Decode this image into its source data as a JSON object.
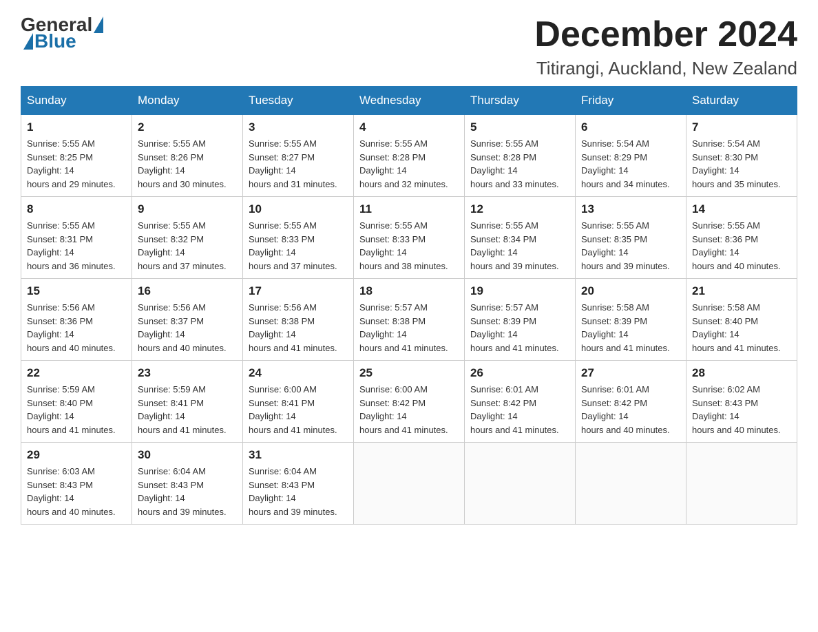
{
  "logo": {
    "general": "General",
    "blue": "Blue"
  },
  "title": "December 2024",
  "subtitle": "Titirangi, Auckland, New Zealand",
  "weekdays": [
    "Sunday",
    "Monday",
    "Tuesday",
    "Wednesday",
    "Thursday",
    "Friday",
    "Saturday"
  ],
  "weeks": [
    [
      {
        "day": "1",
        "sunrise": "5:55 AM",
        "sunset": "8:25 PM",
        "daylight": "14 hours and 29 minutes."
      },
      {
        "day": "2",
        "sunrise": "5:55 AM",
        "sunset": "8:26 PM",
        "daylight": "14 hours and 30 minutes."
      },
      {
        "day": "3",
        "sunrise": "5:55 AM",
        "sunset": "8:27 PM",
        "daylight": "14 hours and 31 minutes."
      },
      {
        "day": "4",
        "sunrise": "5:55 AM",
        "sunset": "8:28 PM",
        "daylight": "14 hours and 32 minutes."
      },
      {
        "day": "5",
        "sunrise": "5:55 AM",
        "sunset": "8:28 PM",
        "daylight": "14 hours and 33 minutes."
      },
      {
        "day": "6",
        "sunrise": "5:54 AM",
        "sunset": "8:29 PM",
        "daylight": "14 hours and 34 minutes."
      },
      {
        "day": "7",
        "sunrise": "5:54 AM",
        "sunset": "8:30 PM",
        "daylight": "14 hours and 35 minutes."
      }
    ],
    [
      {
        "day": "8",
        "sunrise": "5:55 AM",
        "sunset": "8:31 PM",
        "daylight": "14 hours and 36 minutes."
      },
      {
        "day": "9",
        "sunrise": "5:55 AM",
        "sunset": "8:32 PM",
        "daylight": "14 hours and 37 minutes."
      },
      {
        "day": "10",
        "sunrise": "5:55 AM",
        "sunset": "8:33 PM",
        "daylight": "14 hours and 37 minutes."
      },
      {
        "day": "11",
        "sunrise": "5:55 AM",
        "sunset": "8:33 PM",
        "daylight": "14 hours and 38 minutes."
      },
      {
        "day": "12",
        "sunrise": "5:55 AM",
        "sunset": "8:34 PM",
        "daylight": "14 hours and 39 minutes."
      },
      {
        "day": "13",
        "sunrise": "5:55 AM",
        "sunset": "8:35 PM",
        "daylight": "14 hours and 39 minutes."
      },
      {
        "day": "14",
        "sunrise": "5:55 AM",
        "sunset": "8:36 PM",
        "daylight": "14 hours and 40 minutes."
      }
    ],
    [
      {
        "day": "15",
        "sunrise": "5:56 AM",
        "sunset": "8:36 PM",
        "daylight": "14 hours and 40 minutes."
      },
      {
        "day": "16",
        "sunrise": "5:56 AM",
        "sunset": "8:37 PM",
        "daylight": "14 hours and 40 minutes."
      },
      {
        "day": "17",
        "sunrise": "5:56 AM",
        "sunset": "8:38 PM",
        "daylight": "14 hours and 41 minutes."
      },
      {
        "day": "18",
        "sunrise": "5:57 AM",
        "sunset": "8:38 PM",
        "daylight": "14 hours and 41 minutes."
      },
      {
        "day": "19",
        "sunrise": "5:57 AM",
        "sunset": "8:39 PM",
        "daylight": "14 hours and 41 minutes."
      },
      {
        "day": "20",
        "sunrise": "5:58 AM",
        "sunset": "8:39 PM",
        "daylight": "14 hours and 41 minutes."
      },
      {
        "day": "21",
        "sunrise": "5:58 AM",
        "sunset": "8:40 PM",
        "daylight": "14 hours and 41 minutes."
      }
    ],
    [
      {
        "day": "22",
        "sunrise": "5:59 AM",
        "sunset": "8:40 PM",
        "daylight": "14 hours and 41 minutes."
      },
      {
        "day": "23",
        "sunrise": "5:59 AM",
        "sunset": "8:41 PM",
        "daylight": "14 hours and 41 minutes."
      },
      {
        "day": "24",
        "sunrise": "6:00 AM",
        "sunset": "8:41 PM",
        "daylight": "14 hours and 41 minutes."
      },
      {
        "day": "25",
        "sunrise": "6:00 AM",
        "sunset": "8:42 PM",
        "daylight": "14 hours and 41 minutes."
      },
      {
        "day": "26",
        "sunrise": "6:01 AM",
        "sunset": "8:42 PM",
        "daylight": "14 hours and 41 minutes."
      },
      {
        "day": "27",
        "sunrise": "6:01 AM",
        "sunset": "8:42 PM",
        "daylight": "14 hours and 40 minutes."
      },
      {
        "day": "28",
        "sunrise": "6:02 AM",
        "sunset": "8:43 PM",
        "daylight": "14 hours and 40 minutes."
      }
    ],
    [
      {
        "day": "29",
        "sunrise": "6:03 AM",
        "sunset": "8:43 PM",
        "daylight": "14 hours and 40 minutes."
      },
      {
        "day": "30",
        "sunrise": "6:04 AM",
        "sunset": "8:43 PM",
        "daylight": "14 hours and 39 minutes."
      },
      {
        "day": "31",
        "sunrise": "6:04 AM",
        "sunset": "8:43 PM",
        "daylight": "14 hours and 39 minutes."
      },
      null,
      null,
      null,
      null
    ]
  ]
}
